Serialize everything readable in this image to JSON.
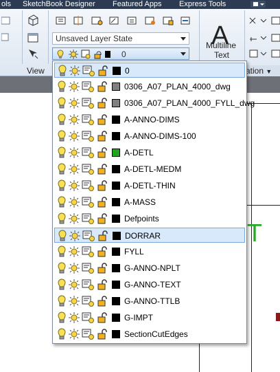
{
  "menu": {
    "items": [
      "ols",
      "SketchBook Designer",
      "Featured Apps",
      "Express Tools"
    ]
  },
  "ribbon": {
    "layer_state_combo": "Unsaved Layer State",
    "layer_combo_value": "0",
    "view_panel_label": "View",
    "multiline_text_line1": "Multiline",
    "multiline_text_line2": "Text",
    "annotation_label_fragment": "ation",
    "big_letter": "A"
  },
  "canvas": {
    "green_glyph": "T"
  },
  "layers": [
    {
      "name": "0",
      "color": "#000000",
      "selected": true
    },
    {
      "name": "0306_A07_PLAN_4000_dwg",
      "color": "#808080"
    },
    {
      "name": "0306_A07_PLAN_4000_FYLL_dwg",
      "color": "#808080"
    },
    {
      "name": "A-ANNO-DIMS",
      "color": "#000000"
    },
    {
      "name": "A-ANNO-DIMS-100",
      "color": "#000000"
    },
    {
      "name": "A-DETL",
      "color": "#1ea51e"
    },
    {
      "name": "A-DETL-MEDM",
      "color": "#000000"
    },
    {
      "name": "A-DETL-THIN",
      "color": "#000000"
    },
    {
      "name": "A-MASS",
      "color": "#000000"
    },
    {
      "name": "Defpoints",
      "color": "#000000"
    },
    {
      "name": "DORRAR",
      "color": "#000000",
      "hover": true
    },
    {
      "name": "FYLL",
      "color": "#000000"
    },
    {
      "name": "G-ANNO-NPLT",
      "color": "#000000"
    },
    {
      "name": "G-ANNO-TEXT",
      "color": "#000000"
    },
    {
      "name": "G-ANNO-TTLB",
      "color": "#000000"
    },
    {
      "name": "G-IMPT",
      "color": "#000000"
    },
    {
      "name": "SectionCutEdges",
      "color": "#000000"
    }
  ],
  "icons": {
    "layer_row": [
      "lightbulb-icon",
      "sun-freeze-icon",
      "viewport-freeze-icon",
      "unlock-icon"
    ]
  },
  "colors": {
    "menubar": "#2c3b52",
    "selection_fill": "#d7e9fb",
    "selection_border": "#78a7d9"
  }
}
